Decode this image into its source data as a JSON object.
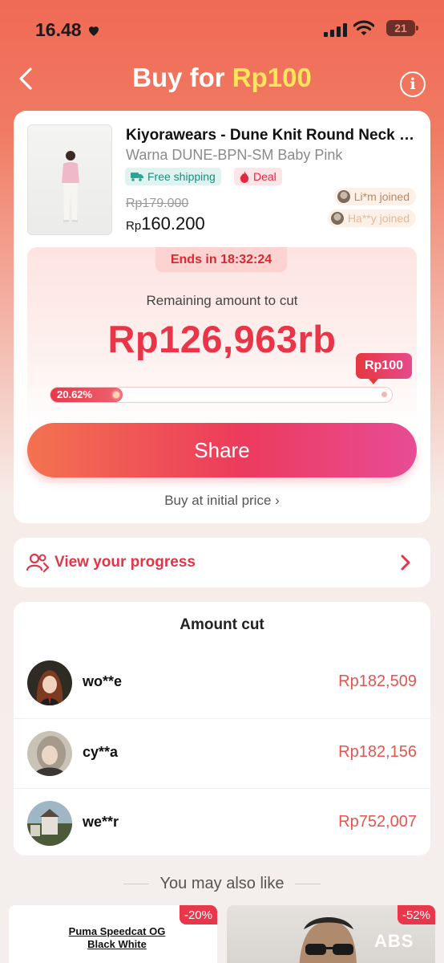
{
  "status_bar": {
    "time": "16.48",
    "battery": "21"
  },
  "header": {
    "title_prefix": "Buy for",
    "title_price": "Rp100"
  },
  "product": {
    "name": "Kiyorawears - Dune Knit Round Neck T...",
    "variant": "Warna DUNE-BPN-SM Baby Pink",
    "tags": {
      "shipping": "Free shipping",
      "deal": "Deal"
    },
    "original_price": "Rp179.000",
    "price_currency": "Rp",
    "price_value": "160.200",
    "joined": [
      "Li*m joined",
      "Ha**y joined"
    ]
  },
  "cut": {
    "ends_in": "Ends in 18:32:24",
    "remaining_label": "Remaining amount to cut",
    "remaining_value": "Rp126,963rb",
    "target_label": "Rp100",
    "progress_label": "20.62%",
    "progress": 0.2062
  },
  "actions": {
    "share": "Share",
    "buy_initial": "Buy at initial price ›"
  },
  "progress_link": {
    "label": "View your progress"
  },
  "amount_cut": {
    "title": "Amount cut",
    "rows": [
      {
        "name": "wo**e",
        "amount": "Rp182,509"
      },
      {
        "name": "cy**a",
        "amount": "Rp182,156"
      },
      {
        "name": "we**r",
        "amount": "Rp752,007"
      }
    ]
  },
  "recommend": {
    "title": "You may also like",
    "items": [
      {
        "title": "Puma Speedcat OG Black White",
        "discount": "-20%"
      },
      {
        "logo": "ABS",
        "discount": "-52%"
      }
    ]
  },
  "colors": {
    "brand": "#ea3447",
    "header_bg": "#f06a55",
    "accent_yellow": "#ffe45c"
  }
}
